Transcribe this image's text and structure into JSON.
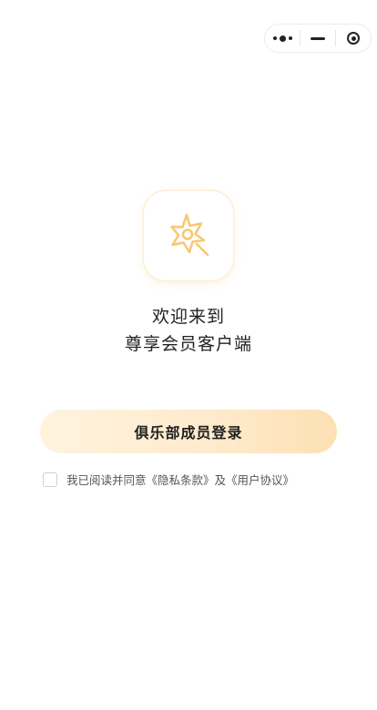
{
  "capsule": {
    "more_icon": "more-dots-icon",
    "minimize_icon": "minus-icon",
    "close_icon": "target-circle-icon"
  },
  "logo": {
    "icon": "star-wand-icon",
    "accent_color": "#f7c872"
  },
  "welcome": {
    "line1": "欢迎来到",
    "line2": "尊享会员客户端"
  },
  "login": {
    "button_label": "俱乐部成员登录",
    "gradient_start": "#fff3df",
    "gradient_end": "#fde0b3"
  },
  "agreement": {
    "prefix": "我已阅读并同意",
    "privacy": "《隐私条款》",
    "conjunction": "及",
    "user_agreement": "《用户协议》"
  }
}
